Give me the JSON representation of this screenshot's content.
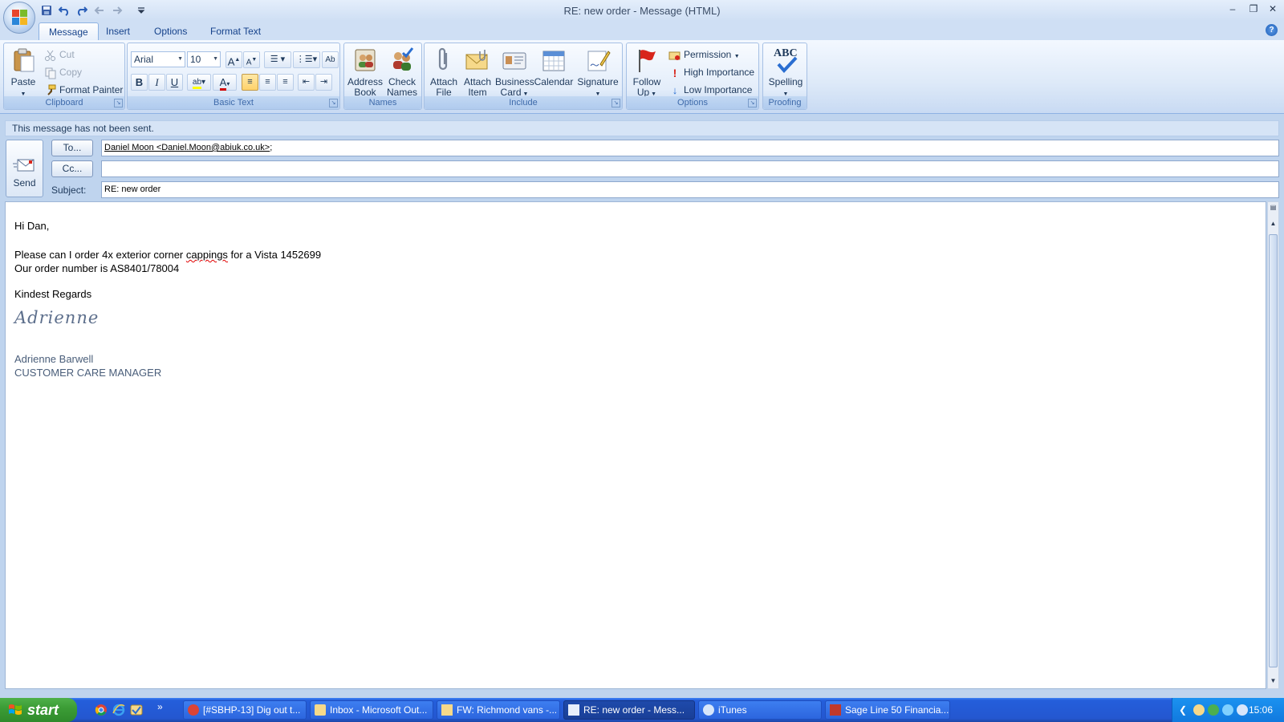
{
  "window": {
    "title": "RE: new order - Message (HTML)",
    "controls": {
      "minimize": "–",
      "restore": "❐",
      "close": "✕"
    }
  },
  "tabs": [
    "Message",
    "Insert",
    "Options",
    "Format Text"
  ],
  "ribbon": {
    "clipboard": {
      "label": "Clipboard",
      "paste": "Paste",
      "cut": "Cut",
      "copy": "Copy",
      "format_painter": "Format Painter"
    },
    "basic_text": {
      "label": "Basic Text",
      "font": "Arial",
      "size": "10"
    },
    "names": {
      "label": "Names",
      "address_book_l1": "Address",
      "address_book_l2": "Book",
      "check_names_l1": "Check",
      "check_names_l2": "Names"
    },
    "include": {
      "label": "Include",
      "attach_file_l1": "Attach",
      "attach_file_l2": "File",
      "attach_item_l1": "Attach",
      "attach_item_l2": "Item",
      "business_card_l1": "Business",
      "business_card_l2": "Card",
      "calendar": "Calendar",
      "signature": "Signature"
    },
    "options": {
      "label": "Options",
      "follow_up_l1": "Follow",
      "follow_up_l2": "Up",
      "permission": "Permission",
      "high_importance": "High Importance",
      "low_importance": "Low Importance"
    },
    "proofing": {
      "label": "Proofing",
      "spelling": "Spelling",
      "spelling_icon_text": "ABC"
    }
  },
  "infobar": "This message has not been sent.",
  "header": {
    "send": "Send",
    "to_button": "To...",
    "cc_button": "Cc...",
    "subject_label": "Subject:",
    "to_value": "Daniel Moon <Daniel.Moon@abiuk.co.uk>",
    "to_suffix": ";",
    "cc_value": "",
    "subject_value": "RE: new order"
  },
  "body": {
    "greeting": "Hi Dan,",
    "line1_a": "Please can I order 4x exterior corner ",
    "line1_misspelled": "cappings",
    "line1_b": " for a Vista 1452699",
    "line2": "Our order number is AS8401/78004",
    "closing": "Kindest Regards",
    "signature_script": "Adrienne",
    "sig_name": "Adrienne Barwell",
    "sig_title": "CUSTOMER CARE MANAGER"
  },
  "taskbar": {
    "start": "start",
    "tasks": [
      "[#SBHP-13] Dig out t...",
      "Inbox - Microsoft Out...",
      "FW: Richmond vans -...",
      "RE: new order - Mess...",
      "iTunes",
      "Sage Line 50 Financia..."
    ],
    "clock": "15:06"
  },
  "colors": {
    "ribbon_accent": "#15428b",
    "taskbar_blue": "#245edb",
    "start_green": "#3c9d36",
    "spell_error": "#e00000"
  }
}
